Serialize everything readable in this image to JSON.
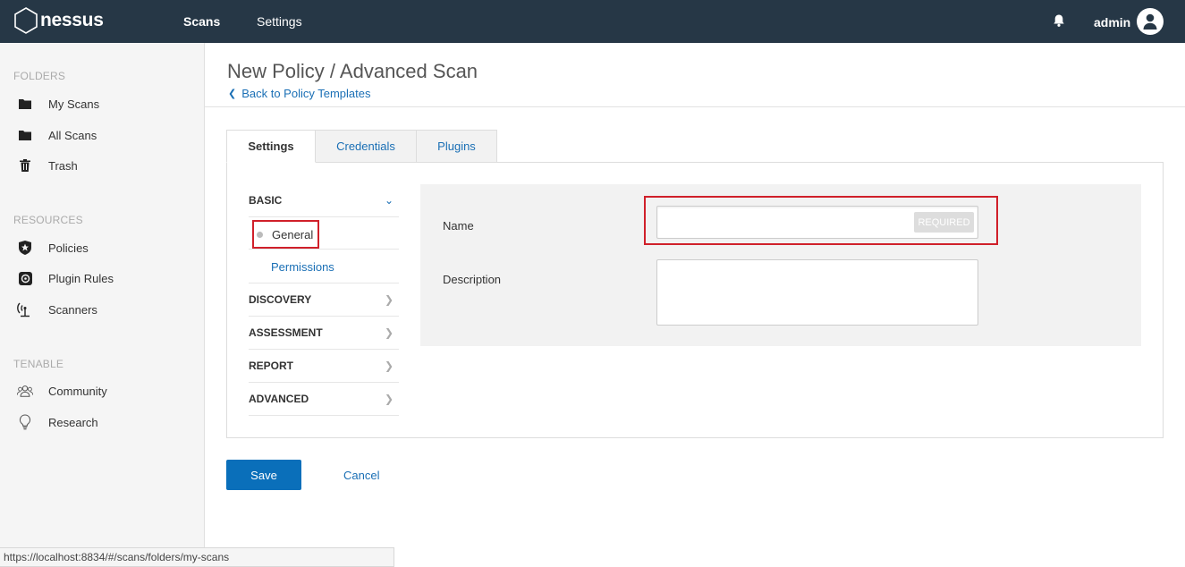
{
  "topbar": {
    "logo_text": "nessus",
    "nav": {
      "scans": "Scans",
      "settings": "Settings"
    },
    "user_name": "admin"
  },
  "sidebar": {
    "folders_heading": "FOLDERS",
    "folders": [
      {
        "label": "My Scans",
        "icon": "folder-icon"
      },
      {
        "label": "All Scans",
        "icon": "folder-icon"
      },
      {
        "label": "Trash",
        "icon": "trash-icon"
      }
    ],
    "resources_heading": "RESOURCES",
    "resources": [
      {
        "label": "Policies",
        "icon": "shield-icon"
      },
      {
        "label": "Plugin Rules",
        "icon": "plugin-icon"
      },
      {
        "label": "Scanners",
        "icon": "radar-icon"
      }
    ],
    "tenable_heading": "TENABLE",
    "tenable": [
      {
        "label": "Community",
        "icon": "people-icon"
      },
      {
        "label": "Research",
        "icon": "lightbulb-icon"
      }
    ]
  },
  "header": {
    "title": "New Policy / Advanced Scan",
    "back_link": "Back to Policy Templates"
  },
  "tabs": [
    {
      "label": "Settings",
      "active": true
    },
    {
      "label": "Credentials",
      "active": false
    },
    {
      "label": "Plugins",
      "active": false
    }
  ],
  "subnav": {
    "basic": "BASIC",
    "general": "General",
    "permissions": "Permissions",
    "discovery": "DISCOVERY",
    "assessment": "ASSESSMENT",
    "report": "REPORT",
    "advanced": "ADVANCED"
  },
  "form": {
    "name_label": "Name",
    "name_value": "",
    "required_badge": "REQUIRED",
    "description_label": "Description",
    "description_value": ""
  },
  "actions": {
    "save": "Save",
    "cancel": "Cancel"
  },
  "status_bar": {
    "url": "https://localhost:8834/#/scans/folders/my-scans"
  },
  "colors": {
    "topbar": "#263746",
    "link": "#1a6fb5",
    "primary_button": "#0a6fba",
    "highlight": "#d0202a"
  }
}
